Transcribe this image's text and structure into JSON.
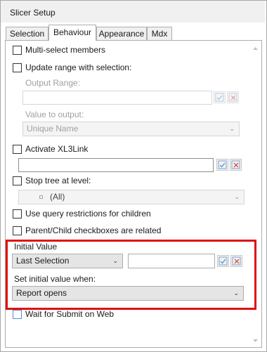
{
  "window": {
    "title": "Slicer Setup"
  },
  "tabs": [
    {
      "label": "Selection"
    },
    {
      "label": "Behaviour"
    },
    {
      "label": "Appearance"
    },
    {
      "label": "Mdx"
    }
  ],
  "behaviour": {
    "multi_select": {
      "label": "Multi-select members"
    },
    "update_range": {
      "label": "Update range with selection:",
      "output_range_label": "Output Range:",
      "output_range_value": "",
      "value_to_output_label": "Value to output:",
      "value_to_output_selected": "Unique Name"
    },
    "xl3link": {
      "label": "Activate XL3Link",
      "value": ""
    },
    "stop_tree": {
      "label": "Stop tree at level:",
      "selected": "(All)"
    },
    "query_restrictions": {
      "label": "Use query restrictions for children"
    },
    "parent_child": {
      "label": "Parent/Child checkboxes are related"
    },
    "initial_value": {
      "label": "Initial Value",
      "selected": "Last Selection",
      "value": "",
      "set_when_label": "Set initial value when:",
      "set_when_selected": "Report opens"
    },
    "wait_submit": {
      "label": "Wait for Submit on Web"
    }
  },
  "colors": {
    "highlight": "#e01010",
    "window_border": "#a7a7a7"
  },
  "icons": {
    "combo_arrow": "chevron-down-icon",
    "apply": "check-icon",
    "clear": "clear-cell-icon",
    "scroll_up": "scroll-up-icon",
    "scroll_down": "scroll-down-icon"
  }
}
